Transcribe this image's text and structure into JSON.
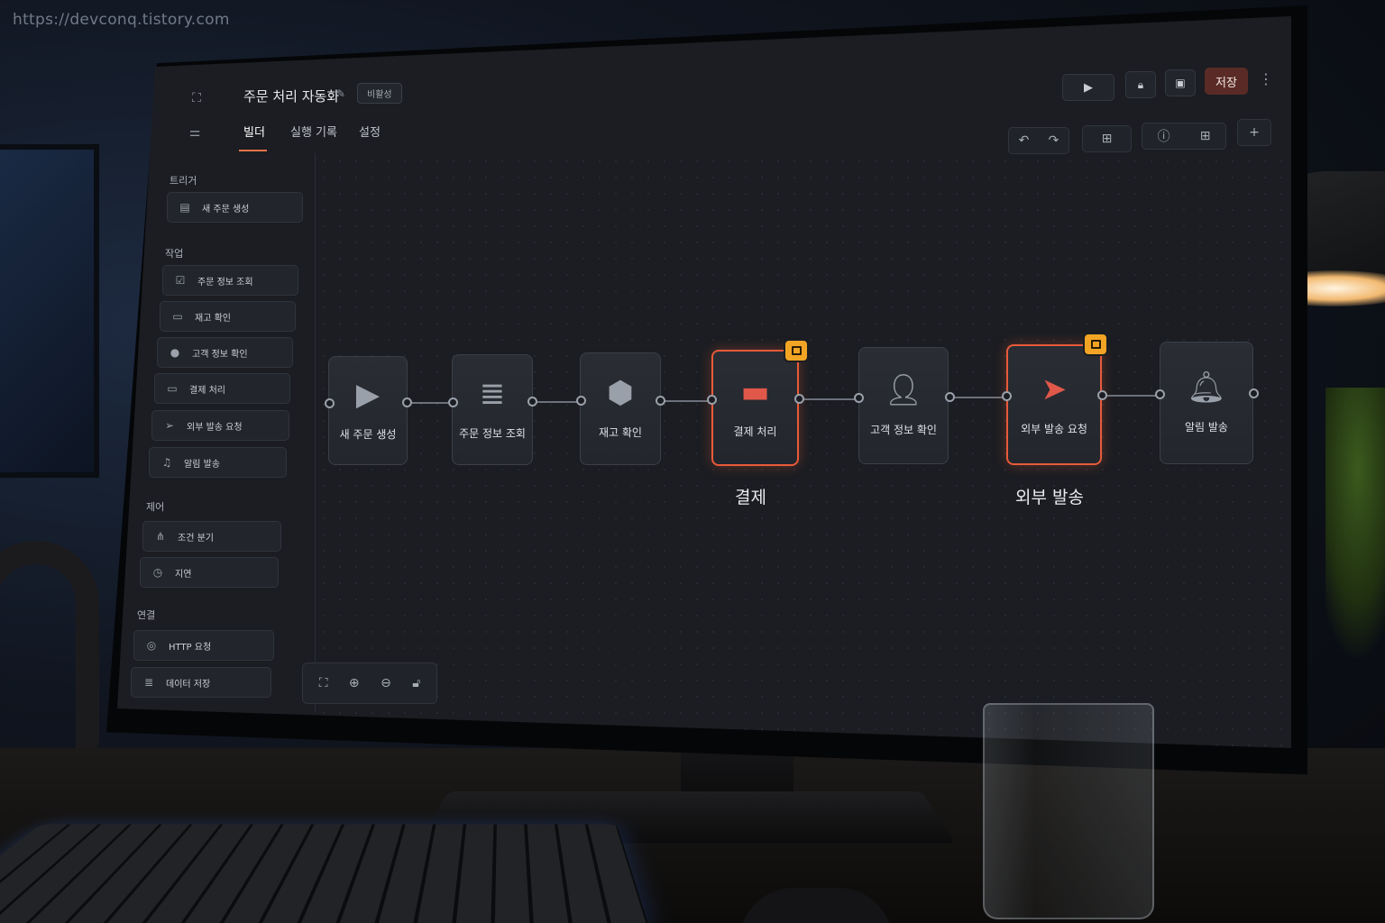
{
  "watermark": "https://devconq.tistory.com",
  "header": {
    "title": "주문 처리 자동화",
    "status_badge": "비활성",
    "save_label": "저장"
  },
  "tabs": [
    {
      "label": "빌더",
      "active": true
    },
    {
      "label": "실행 기록",
      "active": false
    },
    {
      "label": "설정",
      "active": false
    }
  ],
  "sidebar": {
    "sections": [
      {
        "title": "트리거",
        "items": [
          {
            "label": "새 주문 생성",
            "icon": "trigger-doc-icon"
          }
        ]
      },
      {
        "title": "작업",
        "items": [
          {
            "label": "주문 정보 조회",
            "icon": "doc-check-icon"
          },
          {
            "label": "재고 확인",
            "icon": "box-icon"
          },
          {
            "label": "고객 정보 확인",
            "icon": "user-icon"
          },
          {
            "label": "결제 처리",
            "icon": "card-icon"
          },
          {
            "label": "외부 발송 요청",
            "icon": "send-icon"
          },
          {
            "label": "알림 발송",
            "icon": "bell-icon"
          }
        ]
      },
      {
        "title": "제어",
        "items": [
          {
            "label": "조건 분기",
            "icon": "branch-icon"
          },
          {
            "label": "지연",
            "icon": "clock-icon"
          }
        ]
      },
      {
        "title": "연결",
        "items": [
          {
            "label": "HTTP 요청",
            "icon": "globe-icon"
          },
          {
            "label": "데이터 저장",
            "icon": "database-icon"
          }
        ]
      }
    ]
  },
  "workflow": {
    "nodes": [
      {
        "label": "새 주문 생성",
        "icon": "play-icon",
        "alert": false
      },
      {
        "label": "주문 정보 조회",
        "icon": "database-icon",
        "alert": false
      },
      {
        "label": "재고 확인",
        "icon": "box-icon",
        "alert": false
      },
      {
        "label": "결제 처리",
        "icon": "card-icon",
        "alert": true,
        "caption": "결제"
      },
      {
        "label": "고객 정보 확인",
        "icon": "user-icon",
        "alert": false
      },
      {
        "label": "외부 발송 요청",
        "icon": "send-icon",
        "alert": true,
        "caption": "외부 발송"
      },
      {
        "label": "알림 발송",
        "icon": "bell-icon",
        "alert": false
      }
    ]
  },
  "colors": {
    "accent": "#e8744a",
    "alert_border": "#e85b3a",
    "lock_badge": "#f2a524",
    "save_button": "#5a2b26",
    "screen_bg": "#1b1d22"
  }
}
